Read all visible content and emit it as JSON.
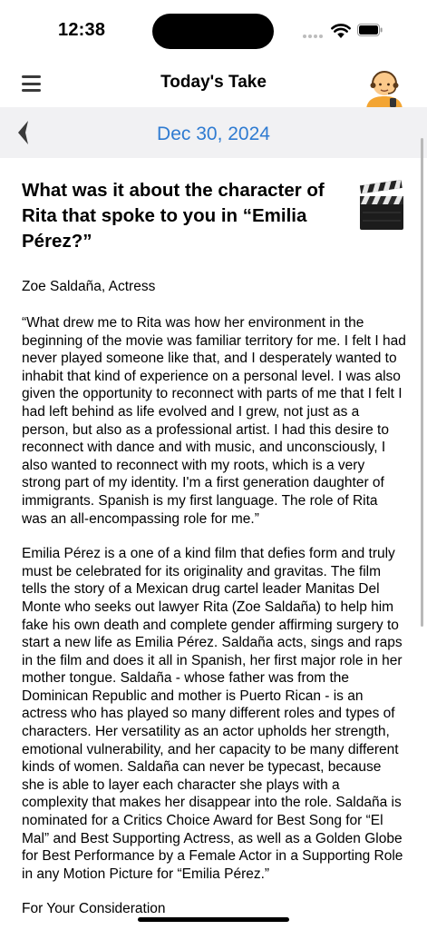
{
  "status": {
    "time": "12:38"
  },
  "nav": {
    "title": "Today's Take"
  },
  "date": {
    "label": "Dec 30, 2024"
  },
  "article": {
    "question": "What was it about the character of Rita that spoke to you in “Emilia Pérez?”",
    "byline": "Zoe Saldaña, Actress",
    "quote": "“What drew me to Rita was how her environment in the beginning of the movie was familiar territory for me. I felt I had never played someone like that, and I desperately wanted to inhabit that kind of experience on a personal level. I was also given the opportunity to reconnect with parts of me that I felt I had left behind as life evolved and I grew, not just as a person, but also as a professional artist. I had this desire to reconnect with dance and with music, and unconsciously, I also wanted to reconnect with my roots, which is a very strong part of my identity. I'm a first generation daughter of immigrants. Spanish is my first language. The role of Rita was an all-encompassing role for me.”",
    "body": "Emilia Pérez is a one of a kind film that defies form and truly must be celebrated for its originality and gravitas. The film tells the story of a Mexican drug cartel leader Manitas Del Monte who seeks out lawyer Rita (Zoe Saldaña) to help him fake his own death and complete gender affirming surgery to start a new life as Emilia Pérez. Saldaña acts, sings and raps in the film and does it all in Spanish, her first major role in her mother tongue. Saldaña - whose father was from the Dominican Republic and mother is Puerto Rican - is an actress who has played so many different roles and types of characters. Her versatility as an actor upholds her strength, emotional vulnerability, and her capacity to be many different kinds of women. Saldaña can never be typecast, because she is able to layer each character she plays with a complexity that makes her disappear into the role. Saldaña is nominated for a Critics Choice Award for Best Song for “El Mal” and Best Supporting Actress, as well as a Golden Globe for Best Performance by a Female Actor in a Supporting Role in any Motion Picture for “Emilia Pérez.”",
    "closing": "For Your Consideration"
  },
  "icons": {
    "menu": "hamburger-menu-icon",
    "avatar": "person-with-headset-icon",
    "back": "chevron-left-icon",
    "clapper": "clapper-board-icon"
  },
  "colors": {
    "accent": "#2f7bd1",
    "date_bar": "#f1f1f3"
  }
}
